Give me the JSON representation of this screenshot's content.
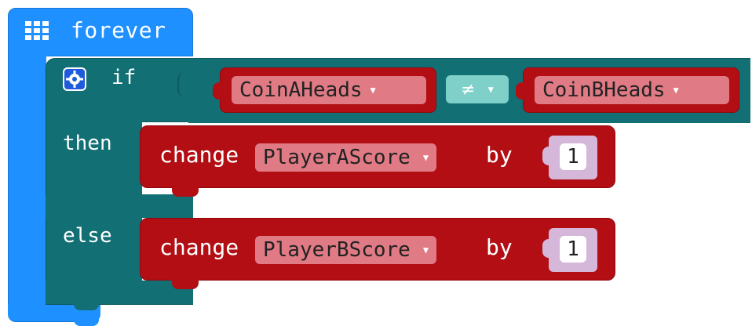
{
  "forever": {
    "label": "forever",
    "icon": "grid-icon",
    "color": "#1e90ff"
  },
  "if_block": {
    "if_label": "if",
    "then_label": "then",
    "else_label": "else",
    "icon": "gear-icon",
    "color": "#126f73",
    "condition": {
      "left_var": "CoinAHeads",
      "operator": "≠",
      "right_var": "CoinBHeads"
    }
  },
  "then_action": {
    "verb": "change",
    "variable": "PlayerAScore",
    "by": "by",
    "amount": "1"
  },
  "else_action": {
    "verb": "change",
    "variable": "PlayerBScore",
    "by": "by",
    "amount": "1"
  },
  "dropdown_caret": "▼",
  "colors": {
    "variable_block": "#b20e14",
    "variable_pill": "#e07a84",
    "operator_pill": "#7fd0c8",
    "number_socket": "#d4b7d9"
  }
}
